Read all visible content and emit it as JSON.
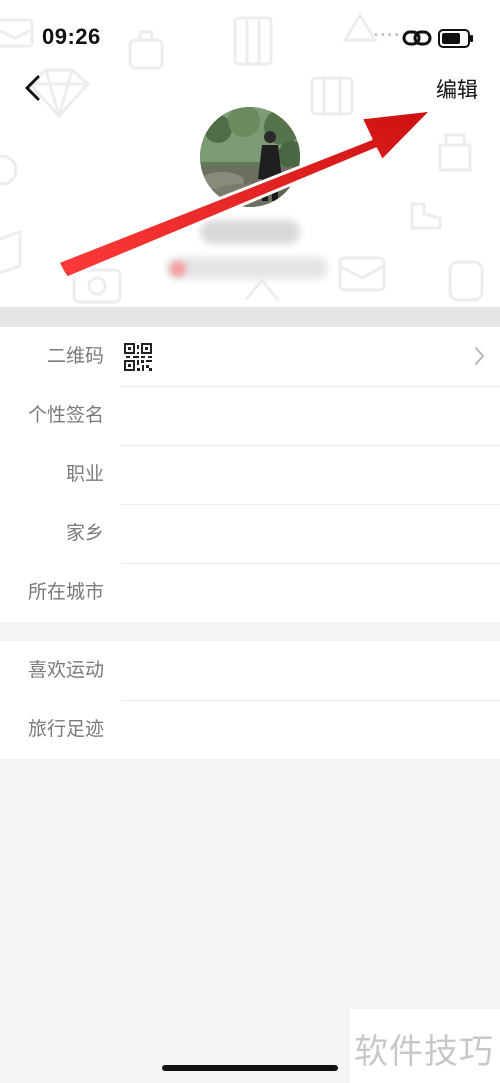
{
  "status_bar": {
    "time": "09:26",
    "signal_dots": "••••"
  },
  "header": {
    "back_icon": "chevron-left-icon",
    "edit_label": "编辑"
  },
  "profile": {
    "avatar": "profile-photo",
    "name_obscured": true,
    "subtitle_obscured": true
  },
  "list1": {
    "rows": [
      {
        "label": "二维码",
        "icon": "qr-code-icon",
        "chevron": true
      },
      {
        "label": "个性签名"
      },
      {
        "label": "职业"
      },
      {
        "label": "家乡"
      },
      {
        "label": "所在城市"
      }
    ]
  },
  "list2": {
    "rows": [
      {
        "label": "喜欢运动"
      },
      {
        "label": "旅行足迹"
      }
    ]
  },
  "annotation": {
    "arrow_color": "#e52222"
  },
  "watermark": {
    "text": "软件技巧"
  }
}
